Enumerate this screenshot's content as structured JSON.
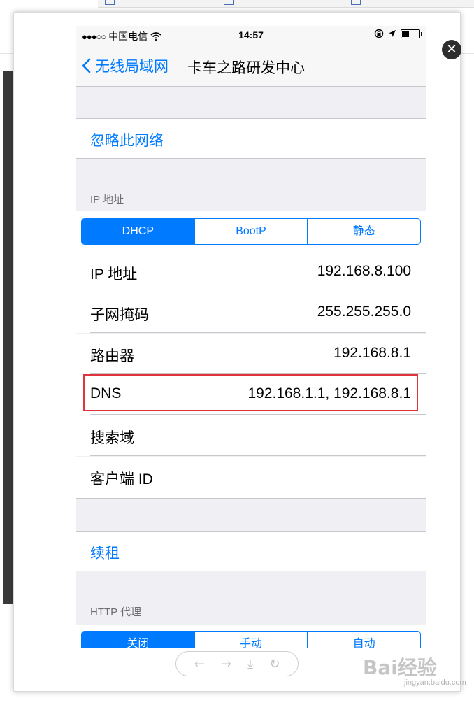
{
  "status_bar": {
    "carrier": "中国电信",
    "signal": "●●●○○",
    "time": "14:57"
  },
  "nav": {
    "back_label": "无线局域网",
    "title": "卡车之路研发中心"
  },
  "forget_network": "忽略此网络",
  "ip_section": {
    "header": "IP 地址",
    "segments": [
      "DHCP",
      "BootP",
      "静态"
    ],
    "selected": "DHCP",
    "rows": [
      {
        "label": "IP 地址",
        "value": "192.168.8.100"
      },
      {
        "label": "子网掩码",
        "value": "255.255.255.0"
      },
      {
        "label": "路由器",
        "value": "192.168.8.1"
      },
      {
        "label": "DNS",
        "value": "192.168.1.1, 192.168.8.1"
      },
      {
        "label": "搜索域",
        "value": ""
      },
      {
        "label": "客户端 ID",
        "value": ""
      }
    ]
  },
  "renew_lease": "续租",
  "http_proxy": {
    "header": "HTTP 代理",
    "segments": [
      "关闭",
      "手动",
      "自动"
    ],
    "selected": "关闭"
  },
  "toolbar": {
    "icons": [
      "arrow-left-icon",
      "arrow-right-icon",
      "download-icon",
      "rotate-icon"
    ]
  },
  "watermark": {
    "brand": "Bai经验",
    "url": "jingyan.baidu.com"
  },
  "colors": {
    "accent": "#007aff",
    "highlight": "#e0333c",
    "grouped_bg": "#efeff4"
  }
}
